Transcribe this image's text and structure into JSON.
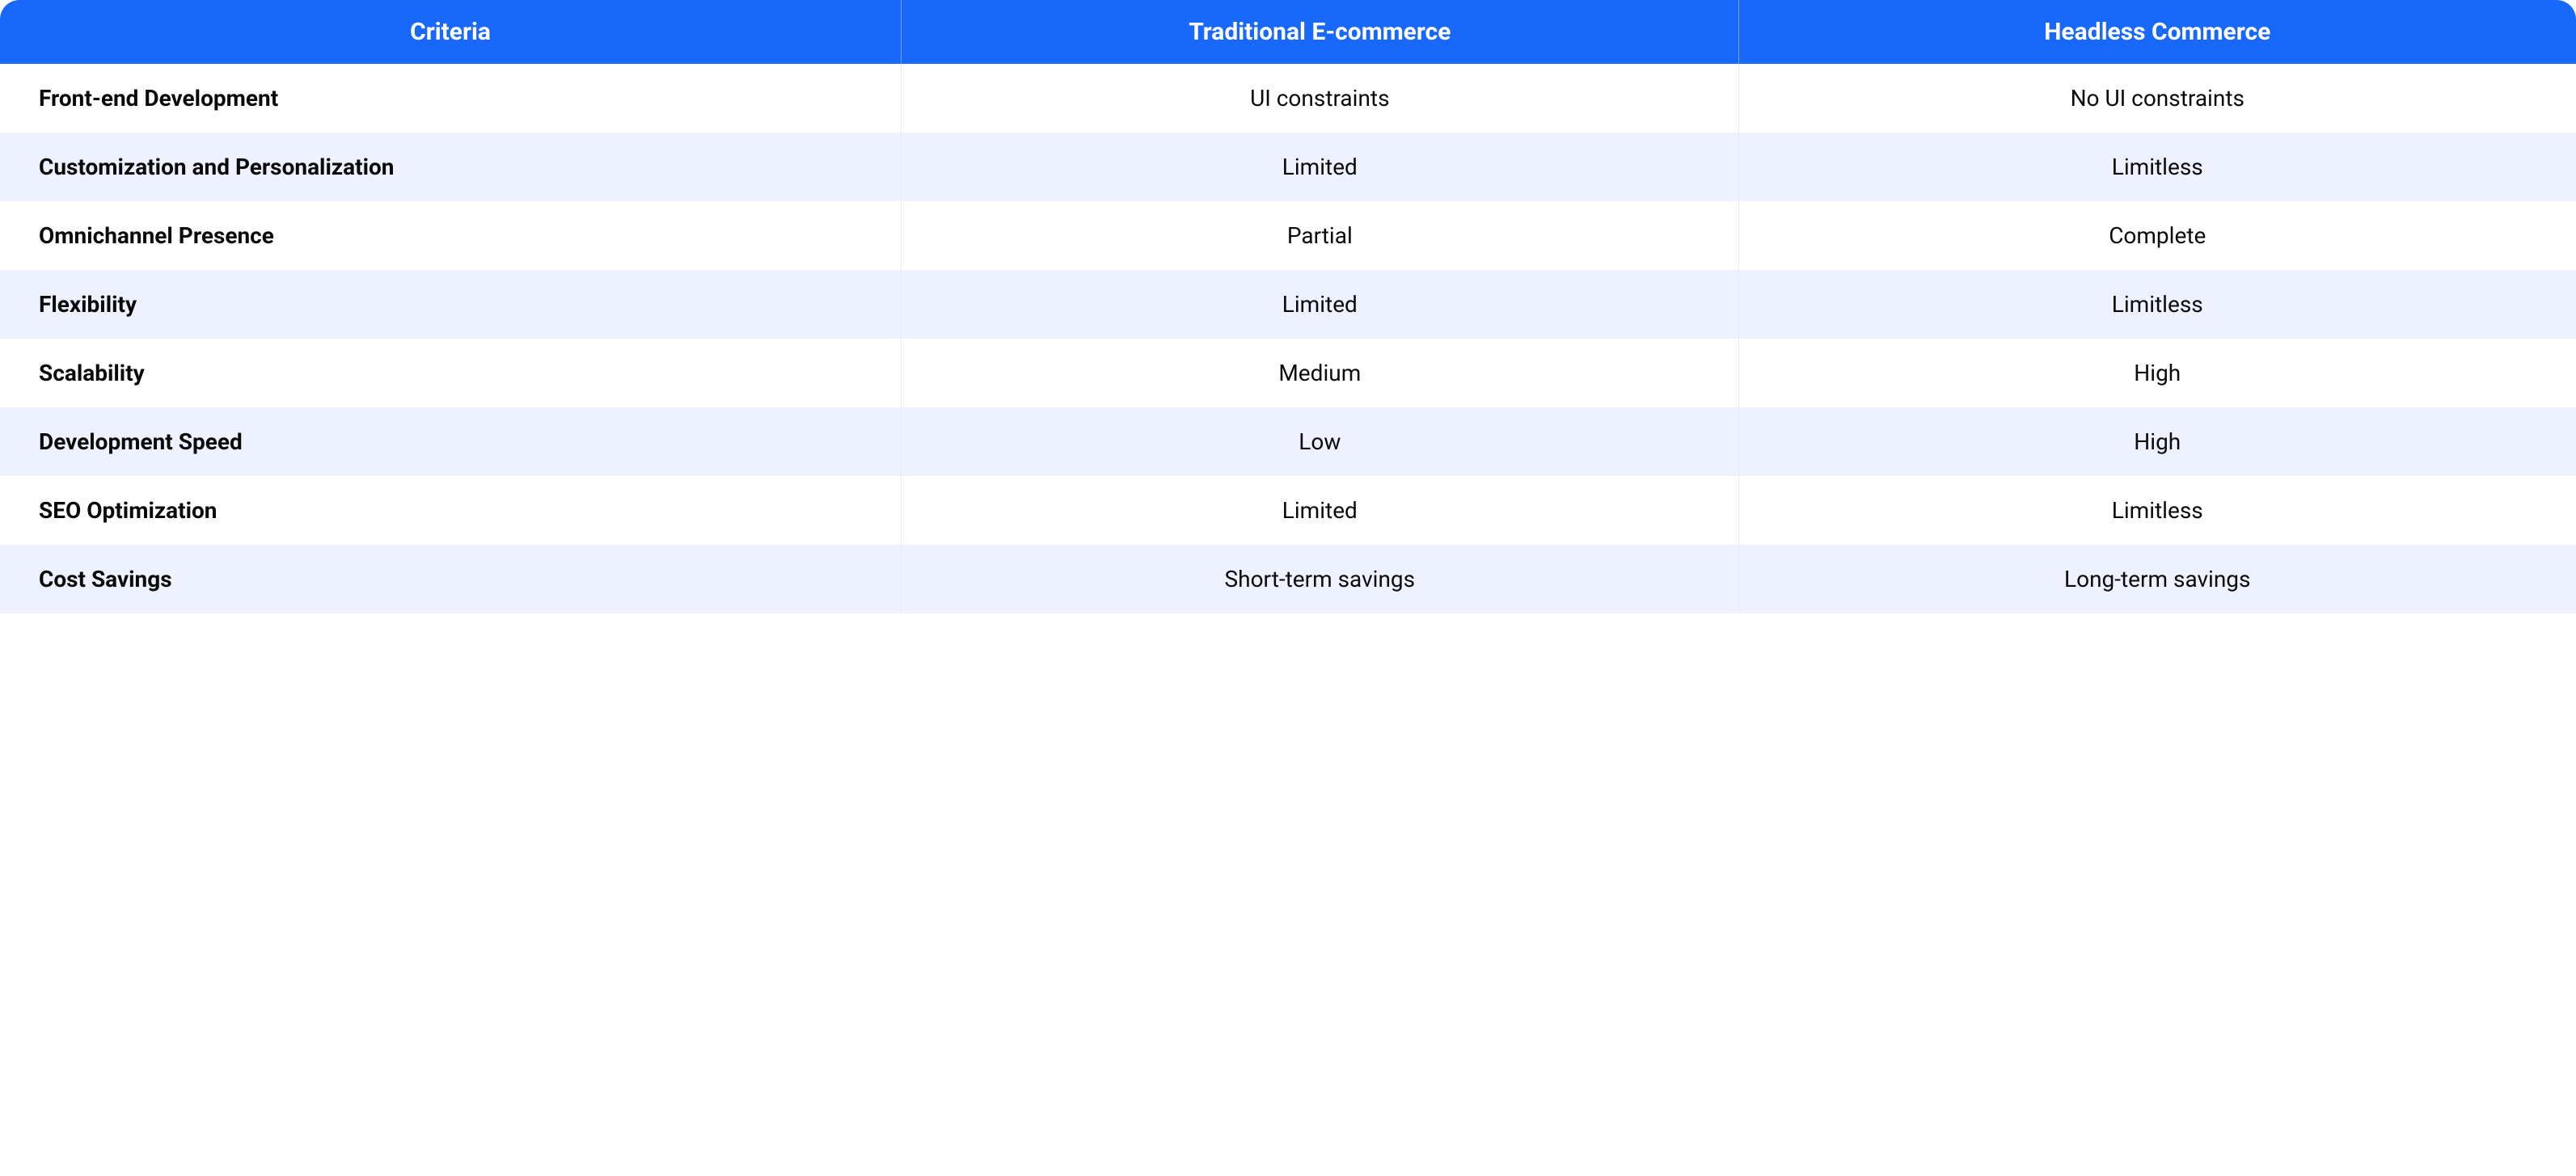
{
  "table": {
    "headers": [
      "Criteria",
      "Traditional E-commerce",
      "Headless Commerce"
    ],
    "rows": [
      {
        "criteria": "Front-end Development",
        "traditional": "UI constraints",
        "headless": "No UI constraints"
      },
      {
        "criteria": "Customization and Personalization",
        "traditional": "Limited",
        "headless": "Limitless"
      },
      {
        "criteria": "Omnichannel Presence",
        "traditional": "Partial",
        "headless": "Complete"
      },
      {
        "criteria": "Flexibility",
        "traditional": "Limited",
        "headless": "Limitless"
      },
      {
        "criteria": "Scalability",
        "traditional": "Medium",
        "headless": "High"
      },
      {
        "criteria": "Development Speed",
        "traditional": "Low",
        "headless": "High"
      },
      {
        "criteria": "SEO Optimization",
        "traditional": "Limited",
        "headless": "Limitless"
      },
      {
        "criteria": "Cost Savings",
        "traditional": "Short-term savings",
        "headless": "Long-term savings"
      }
    ]
  }
}
